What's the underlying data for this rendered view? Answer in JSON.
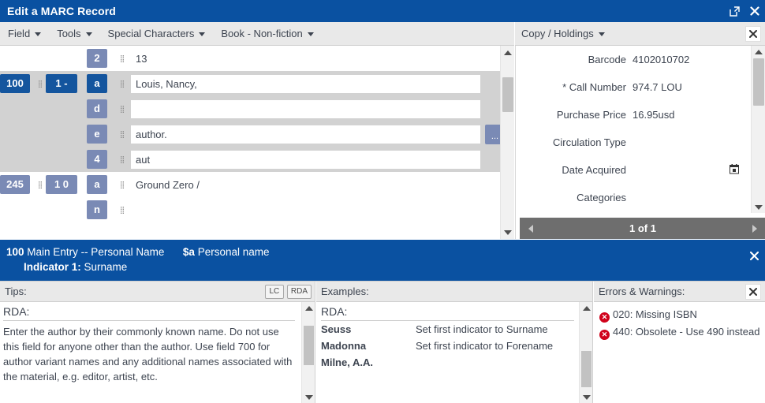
{
  "window": {
    "title": "Edit a MARC Record",
    "popout_icon": "popout-icon",
    "close_icon": "close-icon"
  },
  "menubar": {
    "items": [
      {
        "label": "Field"
      },
      {
        "label": "Tools"
      },
      {
        "label": "Special Characters"
      },
      {
        "label": "Book - Non-fiction"
      }
    ]
  },
  "marc_editor": {
    "groups": [
      {
        "selected": false,
        "rows": [
          {
            "tag": "",
            "indicator": "",
            "subfield": "2",
            "subfield_dark": false,
            "value": "13",
            "editable": false,
            "has_ellipsis": false
          }
        ]
      },
      {
        "selected": true,
        "rows": [
          {
            "tag": "100",
            "tag_dark": true,
            "indicator": "1 -",
            "indicator_dark": true,
            "subfield": "a",
            "subfield_dark": true,
            "value": "Louis, Nancy,",
            "editable": true,
            "has_ellipsis": false
          },
          {
            "tag": "",
            "indicator": "",
            "subfield": "d",
            "subfield_dark": false,
            "value": "",
            "editable": true,
            "has_ellipsis": false
          },
          {
            "tag": "",
            "indicator": "",
            "subfield": "e",
            "subfield_dark": false,
            "value": "author.",
            "editable": true,
            "has_ellipsis": true,
            "ellipsis_label": "..."
          },
          {
            "tag": "",
            "indicator": "",
            "subfield": "4",
            "subfield_dark": false,
            "value": "aut",
            "editable": true,
            "has_ellipsis": false
          }
        ]
      },
      {
        "selected": false,
        "rows": [
          {
            "tag": "245",
            "tag_dark": false,
            "indicator": "1 0",
            "indicator_dark": false,
            "subfield": "a",
            "subfield_dark": false,
            "value": "Ground Zero /",
            "editable": false,
            "has_ellipsis": false
          },
          {
            "tag": "",
            "indicator": "",
            "subfield": "n",
            "subfield_dark": false,
            "value": "",
            "editable": false,
            "has_ellipsis": false
          }
        ]
      }
    ]
  },
  "holdings": {
    "menu_label": "Copy / Holdings",
    "close_icon": "close-icon",
    "rows": [
      {
        "label": "Barcode",
        "value": "4102010702",
        "has_calendar": false
      },
      {
        "label": "* Call Number",
        "value": "974.7 LOU",
        "has_calendar": false
      },
      {
        "label": "Purchase Price",
        "value": "16.95usd",
        "has_calendar": false
      },
      {
        "label": "Circulation Type",
        "value": "",
        "has_calendar": false
      },
      {
        "label": "Date Acquired",
        "value": "",
        "has_calendar": true
      },
      {
        "label": "Categories",
        "value": "",
        "has_calendar": false
      }
    ],
    "pager": {
      "label": "1 of 1",
      "prev_icon": "chevron-left-icon",
      "next_icon": "chevron-right-icon"
    }
  },
  "infobar": {
    "field_tag": "100",
    "field_name": "Main Entry -- Personal Name",
    "subfield_code": "$a",
    "subfield_name": "Personal name",
    "indicator_label": "Indicator 1:",
    "indicator_value": "Surname",
    "close_icon": "close-icon",
    "background_color": "#0a51a1"
  },
  "tips": {
    "header": "Tips:",
    "buttons": [
      {
        "label": "LC"
      },
      {
        "label": "RDA"
      }
    ],
    "section_title": "RDA:",
    "body": "Enter the author by their commonly known name.  Do not use this field for anyone other than the author.  Use field 700 for author variant names and any additional names associated with the material,  e.g. editor, artist, etc."
  },
  "examples": {
    "header": "Examples:",
    "section_title": "RDA:",
    "rows": [
      {
        "term": "Seuss",
        "desc": "Set first indicator to Surname"
      },
      {
        "term": "Madonna",
        "desc": "Set first indicator to Forename"
      },
      {
        "term": "Milne, A.A.",
        "desc": ""
      }
    ]
  },
  "errors": {
    "header": "Errors & Warnings:",
    "close_icon": "close-icon",
    "icon_color": "#d0021b",
    "items": [
      {
        "text": "020: Missing ISBN"
      },
      {
        "text": "440: Obsolete - Use 490 instead"
      }
    ]
  }
}
